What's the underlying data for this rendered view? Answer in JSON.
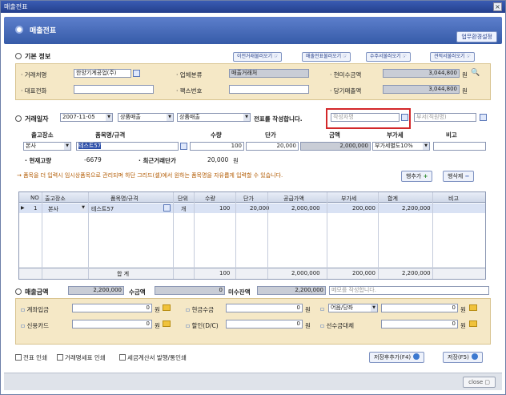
{
  "window_title": "매출전표",
  "header": {
    "title": "매출전표",
    "env_button": "업무환경설정"
  },
  "basic": {
    "title": "기본 정보",
    "btn_prev": "이전거래불러오기 ☞",
    "btn_pre_receipt": "매출전표불러오기 ☞",
    "btn_quote": "수주서불러오기 ☞",
    "btn_estimate": "견적서불러오기 ☞",
    "client_label": "· 거래처명",
    "client_value": "한양기계공업(주)",
    "type_label": "· 업체분류",
    "type_value": "매출거래처",
    "cur_recv_label": "· 현미수금액",
    "cur_recv_value": "3,044,800",
    "cur_recv_unit": "원",
    "rep_phone_label": "· 대표전화",
    "fax_label": "· 팩스번호",
    "period_label": "· 당기매출액",
    "period_value": "3,044,800",
    "period_unit": "원"
  },
  "trade": {
    "date_label": "거래일자",
    "date_value": "2007-11-05",
    "sel1": "상품매출",
    "sel2": "상품매출",
    "msg": "전표를 작성합니다.",
    "writer_placeholder": "작성자명",
    "dept_placeholder": "부서(직원명)"
  },
  "entry": {
    "col_wh": "출고장소",
    "col_item": "품목명/규격",
    "col_qty": "수량",
    "col_price": "단가",
    "col_amt": "금액",
    "col_vat": "부가세",
    "col_note": "비고",
    "wh": "본사",
    "item": "테스트57",
    "qty": "100",
    "price": "20,000",
    "amount": "2,000,000",
    "vat": "부가세별도10%",
    "stock_label": "· 현재고량",
    "stock_value": "-6679",
    "recent_label": "· 최근거래단가",
    "recent_value": "20,000",
    "recent_unit": "원"
  },
  "warning": "→ 품목을 더 입력시 임시상품목으로 관리되며 하단 그리드(셀)에서 원하는 품목명을 자유롭게 입력할 수 있습니다.",
  "grid_buttons": {
    "add": "행추가",
    "del": "행삭제"
  },
  "grid": {
    "headers": [
      "NO",
      "출고장소",
      "품목명/규격",
      "단위",
      "수량",
      "단가",
      "공급가액",
      "부가세",
      "합계",
      "비고"
    ],
    "row": [
      "1",
      "본사",
      "테스트57",
      "개",
      "100",
      "20,000",
      "2,000,000",
      "200,000",
      "2,200,000",
      ""
    ],
    "footer_label": "합  계",
    "footer_qty": "100",
    "footer_supply": "2,000,000",
    "footer_vat": "200,000",
    "footer_total": "2,200,000"
  },
  "finance": {
    "sale_amt_label": "매출금액",
    "sale_amt": "2,200,000",
    "recv_label": "수금액",
    "recv": "0",
    "balance_label": "미수잔액",
    "balance": "2,200,000",
    "memo_placeholder": "메모를 작성합니다.",
    "bank_label": "계좌입금",
    "bank_value": "0",
    "cash_label": "현금수금",
    "cash_value": "0",
    "note_select": "어음/당좌",
    "note_value": "0",
    "card_label": "신용카드",
    "card_value": "0",
    "dc_label": "할인(D/C)",
    "dc_value": "0",
    "advance_label": "선수금대체",
    "advance_value": "0",
    "won": "원"
  },
  "options": {
    "opt1": "전표 인쇄",
    "opt2": "거래명세표 인쇄",
    "opt3": "세금계산서 발행/통인쇄"
  },
  "actions": {
    "save_add": "저장후추가(F4)",
    "save": "저장(F5)",
    "close": "close"
  }
}
